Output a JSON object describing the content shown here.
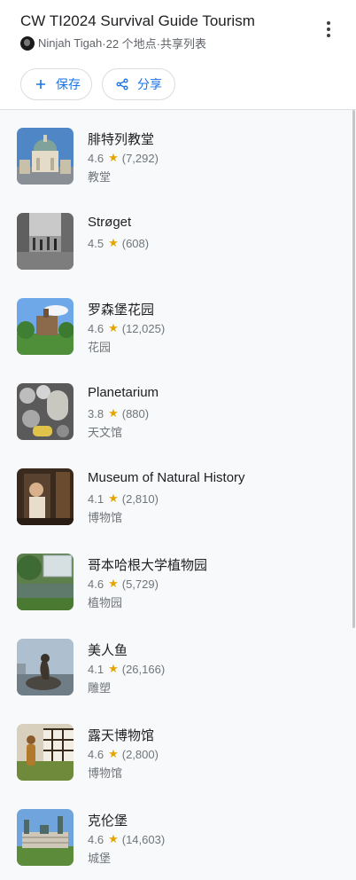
{
  "header": {
    "title": "CW TI2024 Survival Guide Tourism",
    "owner": "Ninjah Tigah",
    "meta": "·22 个地点·共享列表",
    "save_label": "保存",
    "share_label": "分享"
  },
  "icons": {
    "more": "more-vert-icon",
    "save": "plus-icon",
    "share": "share-icon",
    "star": "star-icon"
  },
  "colors": {
    "accent": "#1a73e8",
    "star": "#e2a500",
    "text_secondary": "#70757a"
  },
  "places": [
    {
      "name": "腓特列教堂",
      "rating": "4.6",
      "reviews": "(7,292)",
      "category": "教堂"
    },
    {
      "name": "Strøget",
      "rating": "4.5",
      "reviews": "(608)",
      "category": ""
    },
    {
      "name": "罗森堡花园",
      "rating": "4.6",
      "reviews": "(12,025)",
      "category": "花园"
    },
    {
      "name": "Planetarium",
      "rating": "3.8",
      "reviews": "(880)",
      "category": "天文馆"
    },
    {
      "name": "Museum of Natural History",
      "rating": "4.1",
      "reviews": "(2,810)",
      "category": "博物馆"
    },
    {
      "name": "哥本哈根大学植物园",
      "rating": "4.6",
      "reviews": "(5,729)",
      "category": "植物园"
    },
    {
      "name": "美人鱼",
      "rating": "4.1",
      "reviews": "(26,166)",
      "category": "雕塑"
    },
    {
      "name": "露天博物馆",
      "rating": "4.6",
      "reviews": "(2,800)",
      "category": "博物馆"
    },
    {
      "name": "克伦堡",
      "rating": "4.6",
      "reviews": "(14,603)",
      "category": "城堡"
    }
  ]
}
